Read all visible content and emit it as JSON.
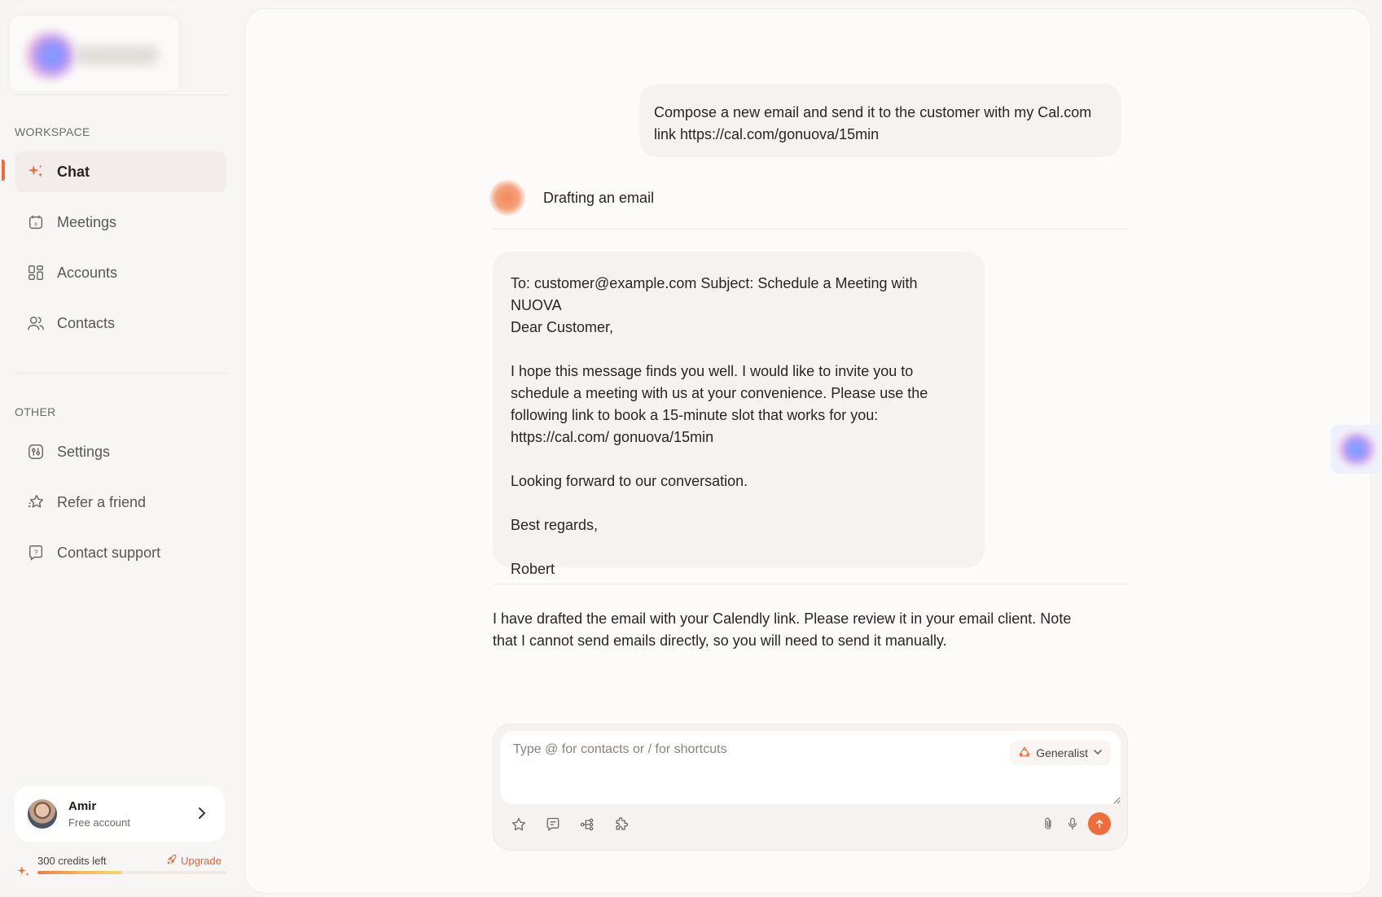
{
  "sidebar": {
    "workspace_label": "WORKSPACE",
    "other_label": "OTHER",
    "workspace_items": [
      {
        "label": "Chat",
        "icon": "sparkle-icon",
        "active": true
      },
      {
        "label": "Meetings",
        "icon": "calendar-icon"
      },
      {
        "label": "Accounts",
        "icon": "grid-icon"
      },
      {
        "label": "Contacts",
        "icon": "users-icon"
      }
    ],
    "other_items": [
      {
        "label": "Settings",
        "icon": "settings-icon"
      },
      {
        "label": "Refer a friend",
        "icon": "star-icon"
      },
      {
        "label": "Contact support",
        "icon": "help-bubble-icon"
      }
    ],
    "user": {
      "name": "Amir",
      "plan": "Free account"
    },
    "credits": {
      "text": "300 credits left",
      "upgrade_label": "Upgrade",
      "fill_fraction": 0.45
    }
  },
  "chat": {
    "user_message": "Compose a new email and send it to the customer with my Cal.com link https://cal.com/gonuova/15min",
    "assistant_status": "Drafting an email",
    "email": {
      "header": "To: customer@example.com Subject: Schedule a Meeting with NUOVA",
      "greeting": "Dear Customer,",
      "body": "I hope this message finds you well. I would like to invite you to schedule a meeting with us at your convenience. Please use the following link to book a 15-minute slot that works for you: https://cal.com/ gonuova/15min",
      "closing_line": "Looking forward to our conversation.",
      "signoff": "Best regards,",
      "signature": "Robert"
    },
    "assistant_reply": "I have drafted the email with your Calendly link. Please review it in your email client. Note that I cannot send emails directly, so you will need to send it manually."
  },
  "composer": {
    "placeholder": "Type @ for contacts or / for shortcuts",
    "mode_label": "Generalist"
  },
  "colors": {
    "accent": "#ee6d3a",
    "background": "#f8f6f5"
  }
}
